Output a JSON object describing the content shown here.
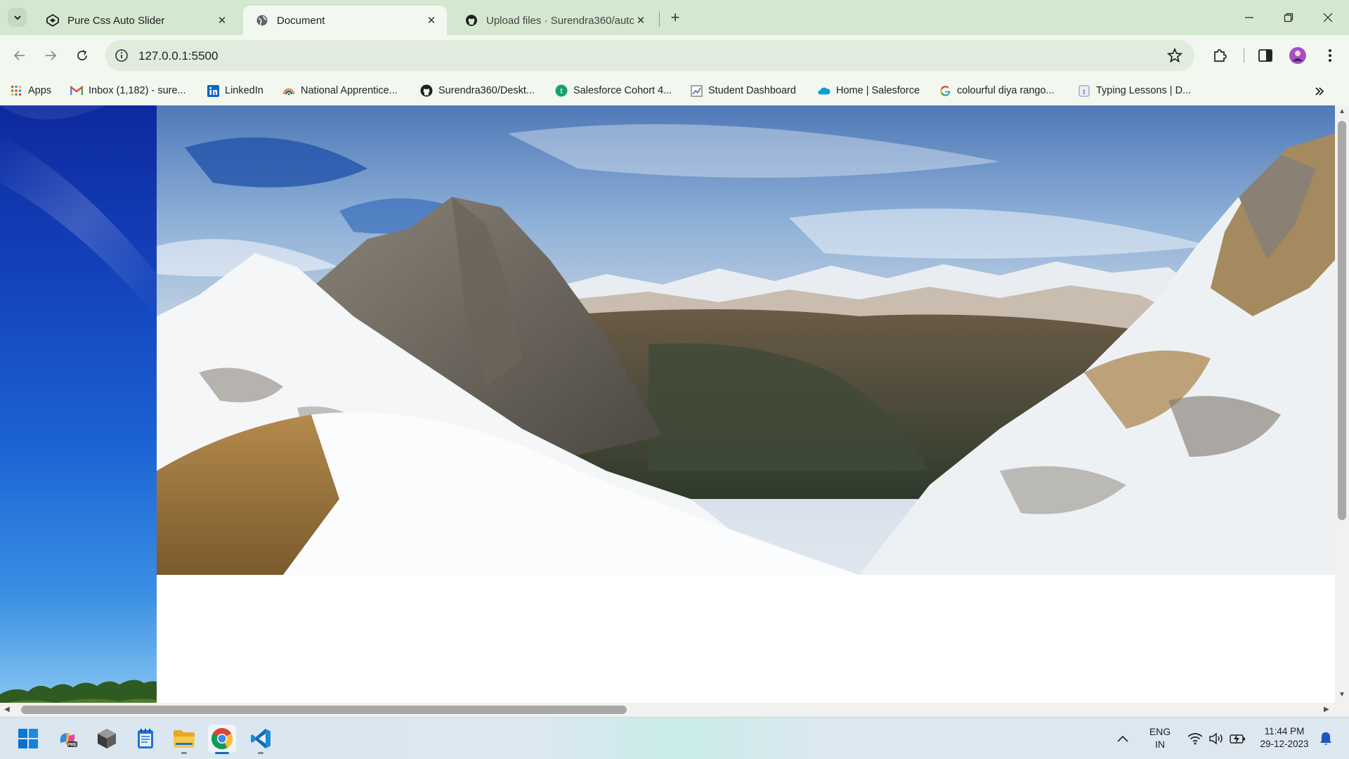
{
  "browser": {
    "tabs": [
      {
        "title": "Pure Css Auto Slider",
        "active": false,
        "favicon": "codepen-icon"
      },
      {
        "title": "Document",
        "active": true,
        "favicon": "globe-icon"
      },
      {
        "title": "Upload files · Surendra360/auto",
        "active": false,
        "favicon": "github-icon"
      }
    ],
    "url": "127.0.0.1:5500",
    "bookmarks": [
      {
        "label": "Apps",
        "icon": "apps-grid-icon"
      },
      {
        "label": "Inbox (1,182) - sure...",
        "icon": "gmail-icon"
      },
      {
        "label": "LinkedIn",
        "icon": "linkedin-icon"
      },
      {
        "label": "National Apprentice...",
        "icon": "apprentice-icon"
      },
      {
        "label": "Surendra360/Deskt...",
        "icon": "github-icon"
      },
      {
        "label": "Salesforce Cohort 4...",
        "icon": "trailhead-icon"
      },
      {
        "label": "Student Dashboard",
        "icon": "dashboard-icon"
      },
      {
        "label": "Home | Salesforce",
        "icon": "salesforce-cloud-icon"
      },
      {
        "label": "colourful diya rango...",
        "icon": "google-icon"
      },
      {
        "label": "Typing Lessons | D...",
        "icon": "typing-icon"
      }
    ]
  },
  "page": {
    "slide_image": "snowy-mountain-panorama",
    "side_image": "blue-sky-wallpaper"
  },
  "taskbar": {
    "apps": [
      "windows-start-icon",
      "copilot-icon",
      "cube-app-icon",
      "notepad-icon",
      "file-explorer-icon",
      "chrome-icon",
      "vscode-icon"
    ],
    "lang_line1": "ENG",
    "lang_line2": "IN",
    "time": "11:44 PM",
    "date": "29-12-2023"
  },
  "colors": {
    "tab_strip": "#d4e8d0",
    "toolbar": "#f2f8f0",
    "omnibox": "#e1ebde"
  }
}
